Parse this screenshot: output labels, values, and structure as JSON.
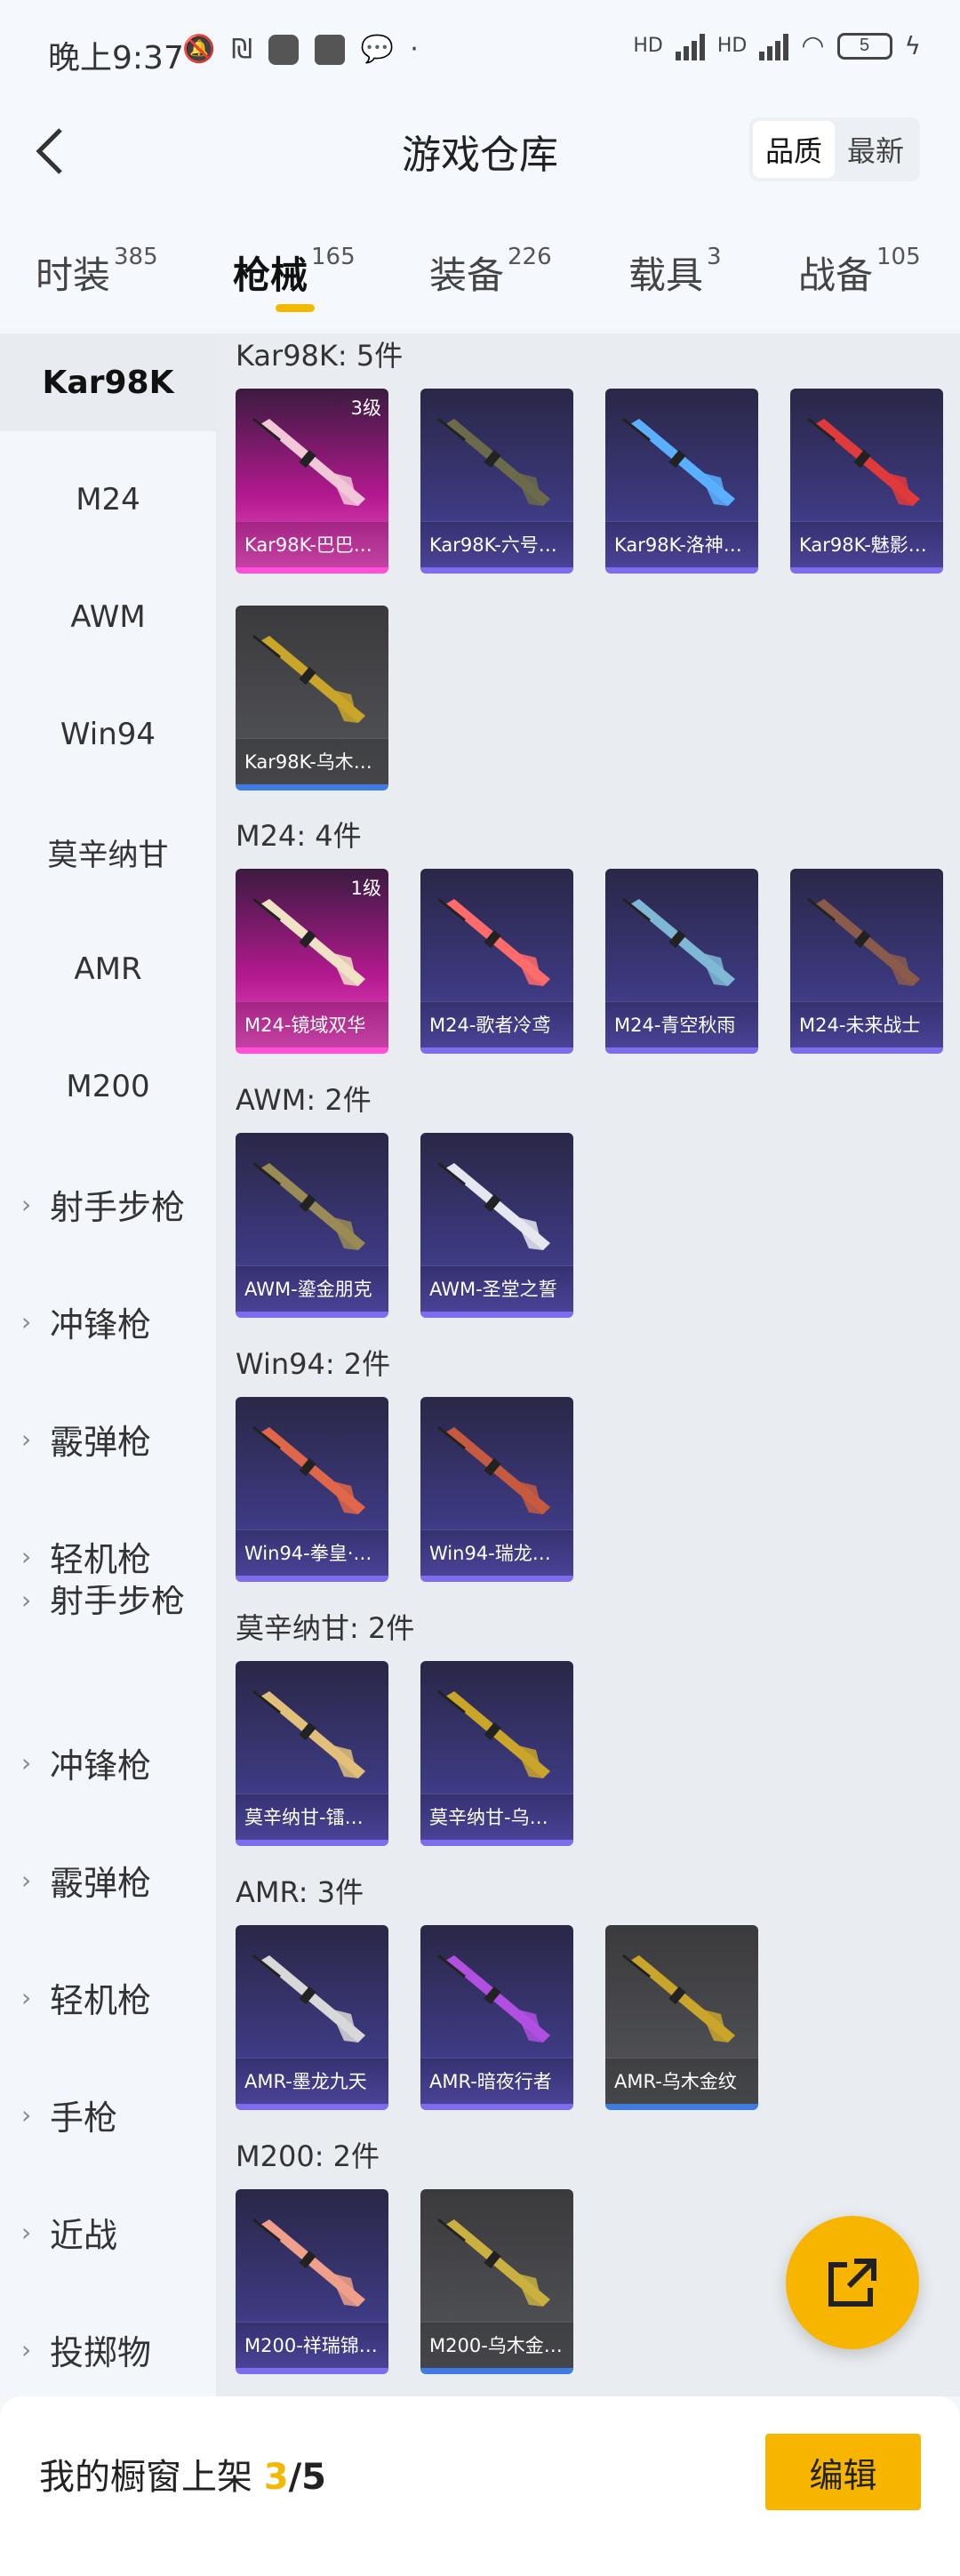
{
  "status_bar": {
    "time": "晚上9:37",
    "hd1": "HD",
    "hd2": "HD",
    "battery": "5"
  },
  "header": {
    "title": "游戏仓库",
    "sort_options": [
      "品质",
      "最新"
    ],
    "sort_selected": "品质"
  },
  "tabs": [
    {
      "label": "时装",
      "count": "385"
    },
    {
      "label": "枪械",
      "count": "165",
      "active": true
    },
    {
      "label": "装备",
      "count": "226"
    },
    {
      "label": "载具",
      "count": "3"
    },
    {
      "label": "战备",
      "count": "105"
    }
  ],
  "sidebar": {
    "models": [
      "Kar98K",
      "M24",
      "AWM",
      "Win94",
      "莫辛纳甘",
      "AMR",
      "M200"
    ],
    "categories": [
      "射手步枪",
      "冲锋枪",
      "霰弹枪",
      "轻机枪",
      "射手步枪",
      "冲锋枪",
      "霰弹枪",
      "轻机枪",
      "手枪",
      "近战",
      "投掷物"
    ]
  },
  "groups": [
    {
      "title": "Kar98K: 5件",
      "items": [
        {
          "name": "Kar98K-巴巴…",
          "rarity": "pink",
          "level": "3级",
          "color": "#f2c7d8"
        },
        {
          "name": "Kar98K-六号…",
          "rarity": "purple",
          "color": "#6b6a4a"
        },
        {
          "name": "Kar98K-洛神…",
          "rarity": "purple",
          "color": "#5ab0ff"
        },
        {
          "name": "Kar98K-魅影…",
          "rarity": "purple",
          "color": "#e03a3a"
        },
        {
          "name": "Kar98K-乌木…",
          "rarity": "gray",
          "color": "#c9a52a"
        }
      ]
    },
    {
      "title": "M24: 4件",
      "items": [
        {
          "name": "M24-镜域双华",
          "rarity": "pink",
          "level": "1级",
          "color": "#f1e2c6"
        },
        {
          "name": "M24-歌者冷鸢",
          "rarity": "purple",
          "color": "#ff6b6b"
        },
        {
          "name": "M24-青空秋雨",
          "rarity": "purple",
          "color": "#7fb8d6"
        },
        {
          "name": "M24-未来战士",
          "rarity": "purple",
          "color": "#8a5a4a"
        }
      ]
    },
    {
      "title": "AWM: 2件",
      "items": [
        {
          "name": "AWM-鎏金朋克",
          "rarity": "purple",
          "color": "#9a8a55"
        },
        {
          "name": "AWM-圣堂之誓",
          "rarity": "purple",
          "color": "#e6e6f0"
        }
      ]
    },
    {
      "title": "Win94: 2件",
      "items": [
        {
          "name": "Win94-拳皇·…",
          "rarity": "purple",
          "color": "#e0664a"
        },
        {
          "name": "Win94-瑞龙…",
          "rarity": "purple",
          "color": "#c55a40"
        }
      ]
    },
    {
      "title": "莫辛纳甘: 2件",
      "items": [
        {
          "name": "莫辛纳甘-镭…",
          "rarity": "purple",
          "color": "#e2c07a"
        },
        {
          "name": "莫辛纳甘-乌…",
          "rarity": "purple",
          "color": "#c9a52a"
        }
      ]
    },
    {
      "title": "AMR: 3件",
      "items": [
        {
          "name": "AMR-墨龙九天",
          "rarity": "purple",
          "color": "#d8d8d8"
        },
        {
          "name": "AMR-暗夜行者",
          "rarity": "purple",
          "color": "#b04fe0"
        },
        {
          "name": "AMR-乌木金纹",
          "rarity": "gray",
          "color": "#c9a52a"
        }
      ]
    },
    {
      "title": "M200: 2件",
      "items": [
        {
          "name": "M200-祥瑞锦…",
          "rarity": "purple",
          "color": "#f0a08a"
        },
        {
          "name": "M200-乌木金…",
          "rarity": "gray",
          "color": "#c9b040"
        }
      ]
    }
  ],
  "bottom": {
    "label": "我的橱窗上架",
    "count": "3",
    "total": "/5",
    "edit_label": "编辑"
  },
  "colors": {
    "accent": "#f7b500",
    "pink": "#f050c8",
    "purple": "#5a52b8"
  }
}
